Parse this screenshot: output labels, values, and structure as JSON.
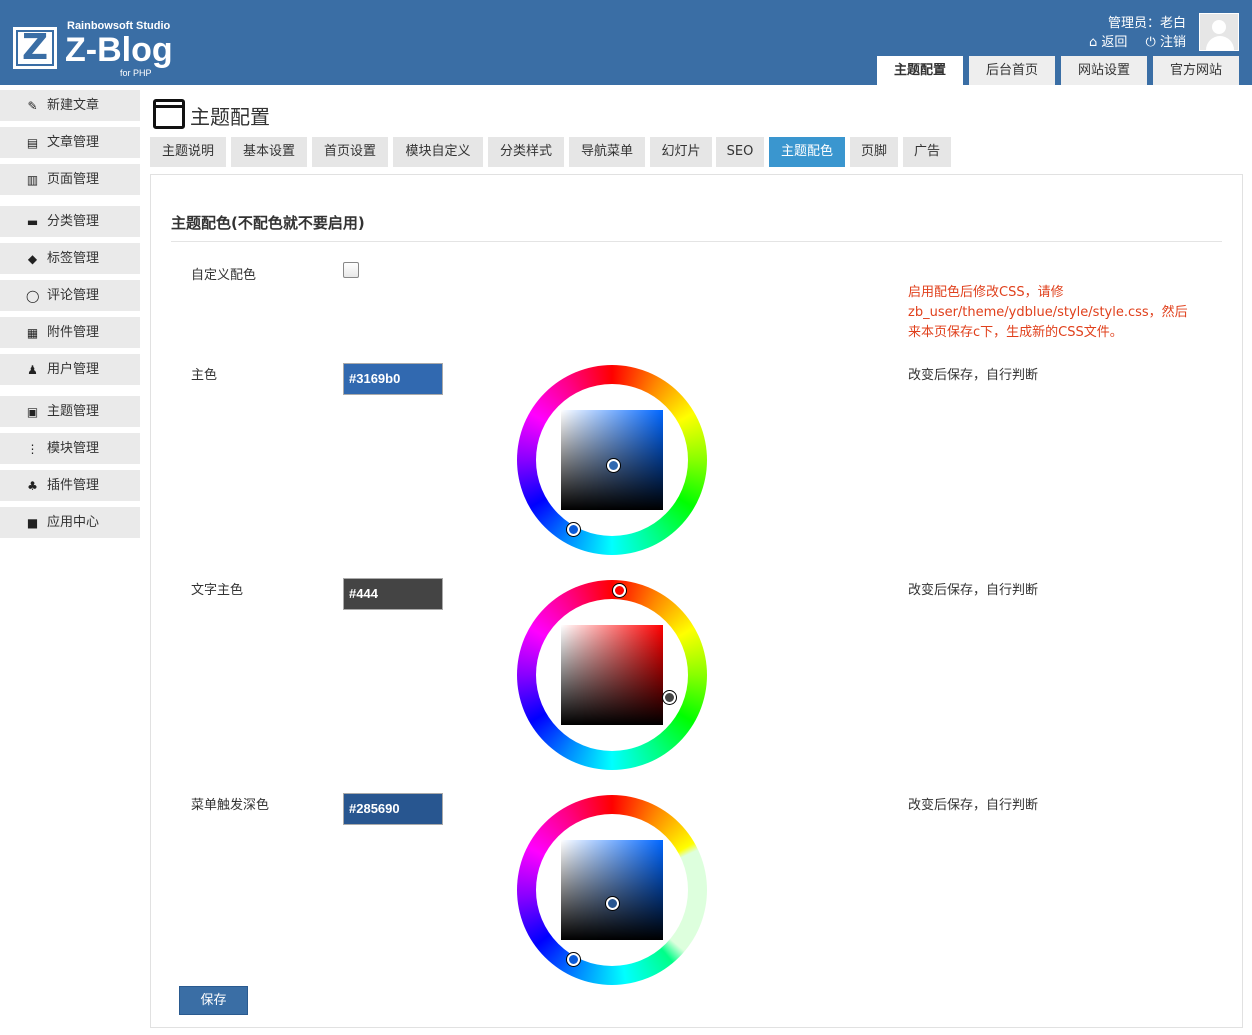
{
  "header": {
    "logo_studio": "Rainbowsoft Studio",
    "logo_name": "Z-Blog",
    "logo_sub": "for PHP",
    "logo_letter": "Z",
    "user_line": "管理员：老白",
    "back_label": "返回",
    "logout_label": "注销",
    "nav": [
      "主题配置",
      "后台首页",
      "网站设置",
      "官方网站"
    ],
    "active_nav": "主题配置",
    "brand_color": "#3a6ea5"
  },
  "sidebar": {
    "items": [
      {
        "label": "新建文章",
        "icon": "edit-icon"
      },
      {
        "label": "文章管理",
        "icon": "article-icon"
      },
      {
        "label": "页面管理",
        "icon": "page-icon"
      },
      {
        "label": "分类管理",
        "icon": "folder-icon"
      },
      {
        "label": "标签管理",
        "icon": "tag-icon"
      },
      {
        "label": "评论管理",
        "icon": "comment-icon"
      },
      {
        "label": "附件管理",
        "icon": "attachment-icon"
      },
      {
        "label": "用户管理",
        "icon": "user-icon"
      },
      {
        "label": "主题管理",
        "icon": "theme-icon"
      },
      {
        "label": "模块管理",
        "icon": "module-icon"
      },
      {
        "label": "插件管理",
        "icon": "plugin-icon"
      },
      {
        "label": "应用中心",
        "icon": "app-center-icon"
      }
    ]
  },
  "main": {
    "title": "主题配置",
    "tabs": [
      "主题说明",
      "基本设置",
      "首页设置",
      "模块自定义",
      "分类样式",
      "导航菜单",
      "幻灯片",
      "SEO",
      "主题配色",
      "页脚",
      "广告"
    ],
    "active_tab": "主题配色",
    "active_tab_color": "#3a96cf",
    "section_title": "主题配色(不配色就不要启用)",
    "custom_color_label": "自定义配色",
    "custom_color_checked": false,
    "note_lines": [
      "启用配色后修改CSS，请修",
      "zb_user/theme/ydblue/style/style.css，然后",
      "来本页保存c下，生成新的CSS文件。"
    ],
    "note_color": "#e0401c",
    "color_rows": [
      {
        "label": "主色",
        "value": "#3169b0",
        "note": "改变后保存，自行判断"
      },
      {
        "label": "文字主色",
        "value": "#444",
        "note": "改变后保存，自行判断"
      },
      {
        "label": "菜单触发深色",
        "value": "#285690",
        "note": "改变后保存，自行判断"
      }
    ],
    "save_label": "保存"
  }
}
